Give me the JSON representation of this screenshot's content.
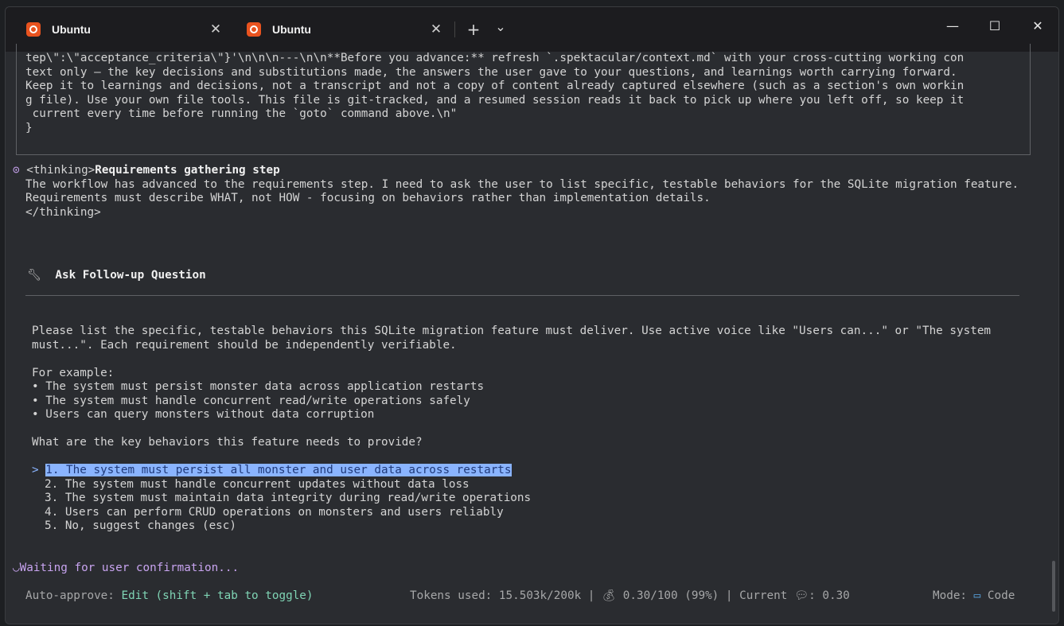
{
  "tabs": [
    {
      "title": "Ubuntu",
      "close": "✕"
    },
    {
      "title": "Ubuntu",
      "close": "✕"
    }
  ],
  "tabbar": {
    "new_tab": "+",
    "dropdown": "⌄"
  },
  "window_controls": {
    "minimize": "—",
    "maximize": "☐",
    "close": "✕"
  },
  "tool_output": {
    "lines": [
      "tep\\\":\\\"acceptance_criteria\\\"}'\\n\\n\\n---\\n\\n**Before you advance:** refresh `.spektacular/context.md` with your cross-cutting working con",
      "text only — the key decisions and substitutions made, the answers the user gave to your questions, and learnings worth carrying forward.",
      "Keep it to learnings and decisions, not a transcript and not a copy of content already captured elsewhere (such as a section's own workin",
      "g file). Use your own file tools. This file is git-tracked, and a resumed session reads it back to pick up where you left off, so keep it",
      " current every time before running the `goto` command above.\\n\"",
      "}"
    ]
  },
  "thinking": {
    "open_tag": "<thinking>",
    "title": "Requirements gathering step",
    "body": [
      "The workflow has advanced to the requirements step. I need to ask the user to list specific, testable behaviors for the SQLite migration feature.",
      "Requirements must describe WHAT, not HOW - focusing on behaviors rather than implementation details."
    ],
    "close_tag": "</thinking>"
  },
  "followup": {
    "heading": "Ask Follow-up Question",
    "question": [
      "Please list the specific, testable behaviors this SQLite migration feature must deliver. Use active voice like \"Users can...\" or \"The system",
      "must...\". Each requirement should be independently verifiable."
    ],
    "example_label": "For example:",
    "examples": [
      "• The system must persist monster data across application restarts",
      "• The system must handle concurrent read/write operations safely",
      "• Users can query monsters without data corruption"
    ],
    "prompt": "What are the key behaviors this feature needs to provide?",
    "selected_marker": ">",
    "options": [
      "1. The system must persist all monster and user data across restarts",
      "2. The system must handle concurrent updates without data loss",
      "3. The system must maintain data integrity during read/write operations",
      "4. Users can perform CRUD operations on monsters and users reliably",
      "5. No, suggest changes (esc)"
    ]
  },
  "status": {
    "waiting": "Waiting for user confirmation...",
    "auto_approve_label": "Auto-approve:",
    "auto_approve_value": "Edit (shift + tab to toggle)",
    "tokens": "Tokens used: 15.503k/200k |",
    "cost": "0.30/100 (99%) | Current",
    "current": "0.30",
    "mode_label": "Mode:",
    "mode_value": "Code"
  },
  "colors": {
    "background": "#2a2c30",
    "accent_green": "#7fd4b4",
    "accent_purple": "#c8a4f0",
    "selection": "#8ab4ff",
    "ubuntu_orange": "#e9531f"
  }
}
